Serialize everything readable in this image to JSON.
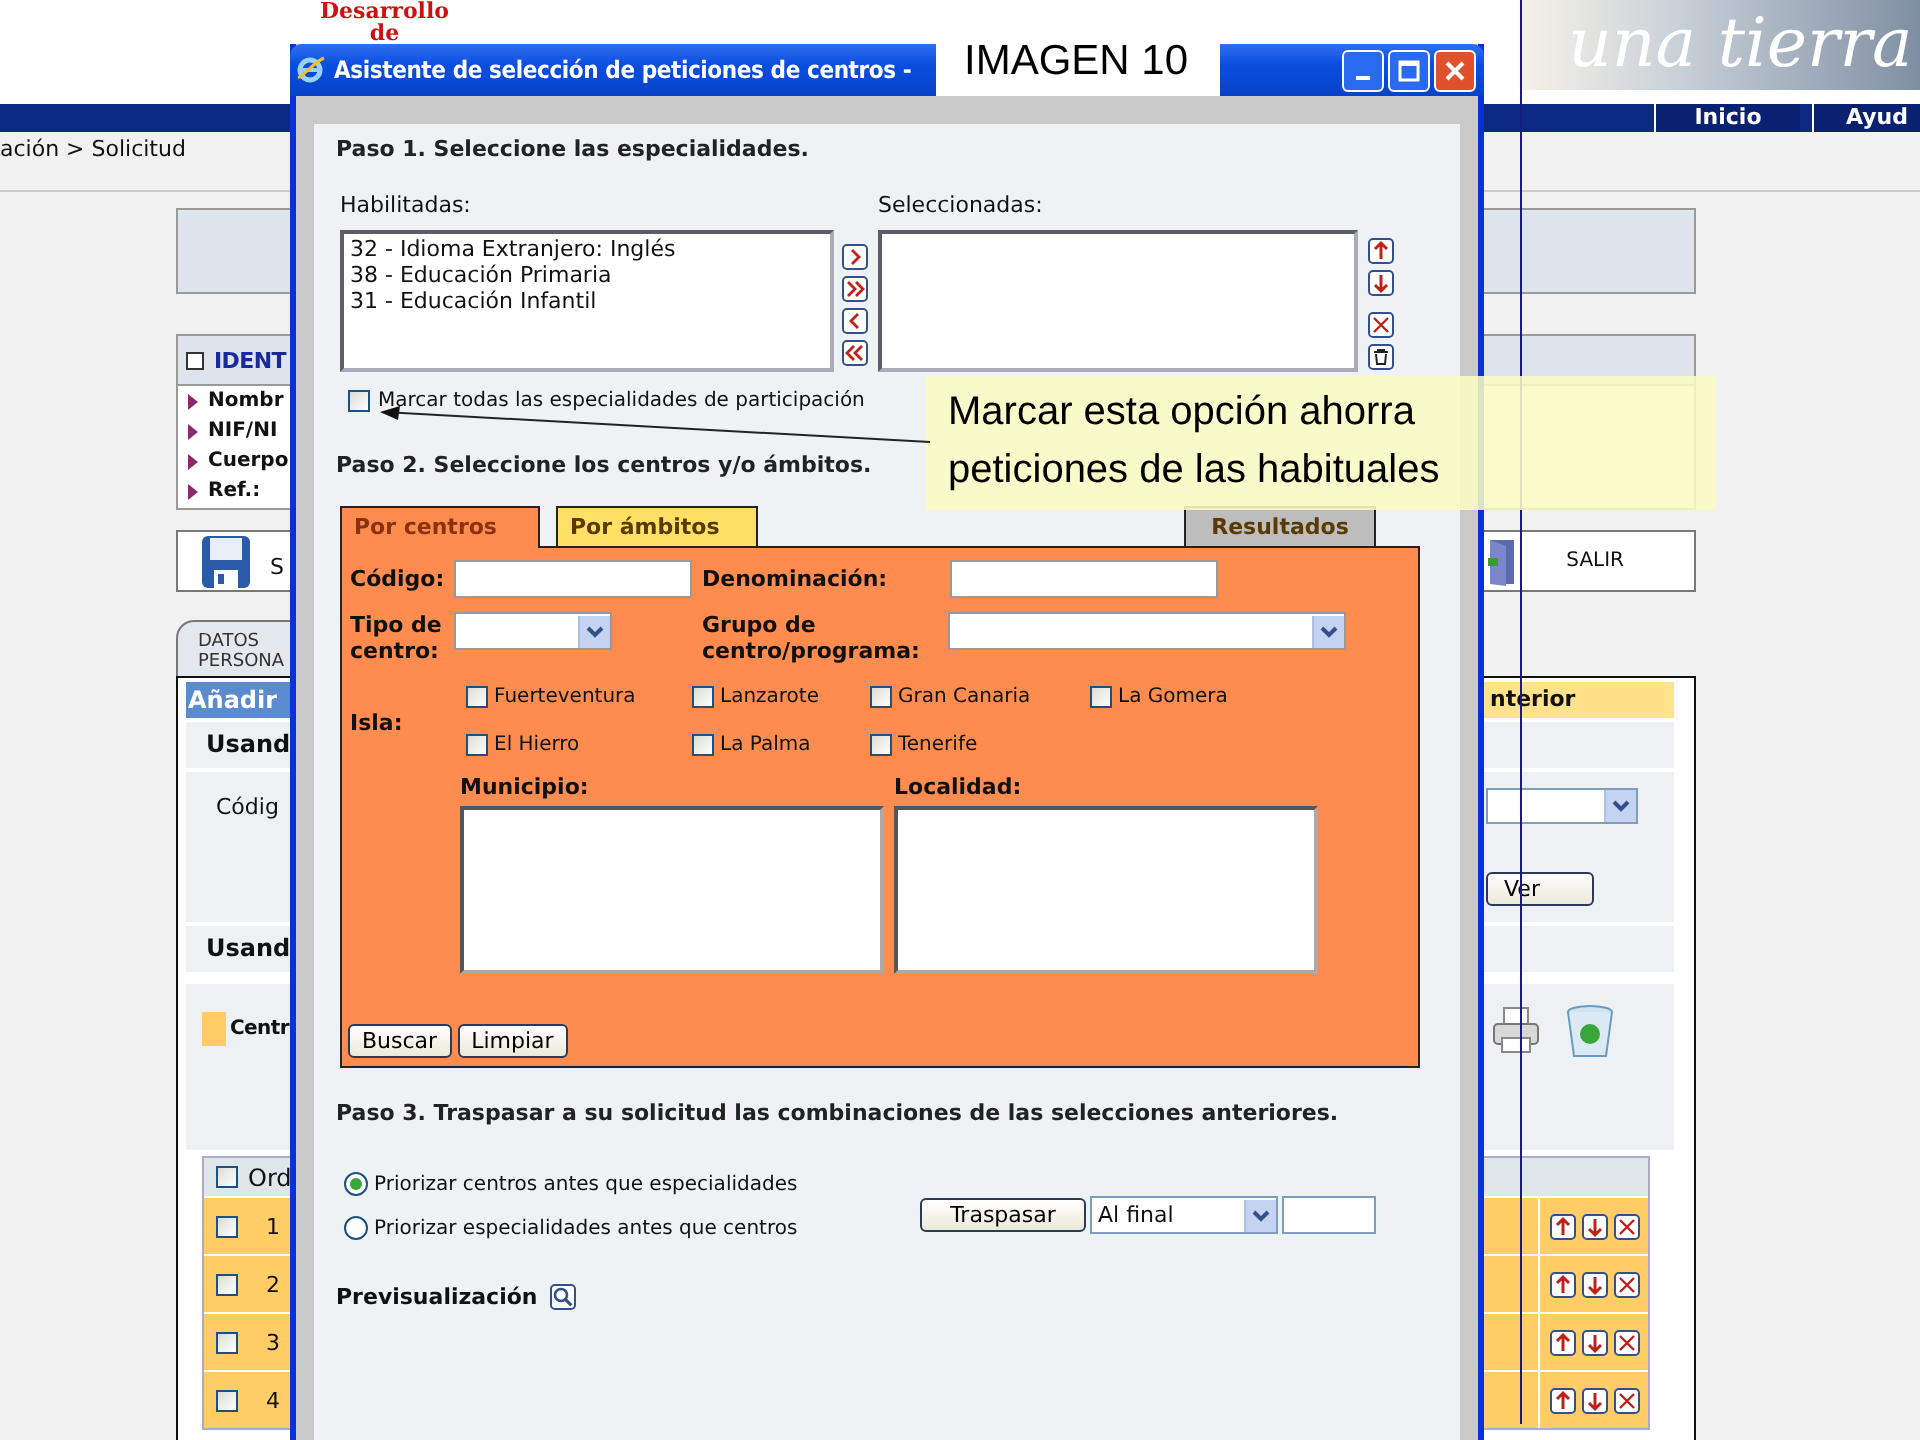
{
  "page": {
    "header": {
      "org_lines": [
        "Desarrollo",
        "de"
      ],
      "banner_text": "una tierra"
    },
    "nav": [
      {
        "label": "Inicio"
      },
      {
        "label": "Ayud"
      }
    ],
    "breadcrumb": "ación > Solicitud",
    "identification": {
      "title": "IDENT",
      "fields": [
        "Nombr",
        "NIF/NI",
        "Cuerpo",
        "Ref.:"
      ]
    },
    "toolbar": {
      "save_label": "S",
      "exit_label": "SALIR"
    },
    "tab": {
      "lines": [
        "DATOS",
        "PERSONA"
      ]
    },
    "section": {
      "title": "Añadir",
      "side_title": "nterior",
      "subheading_1": "Usand",
      "code_label": "Códig",
      "view_button": "Ver",
      "subheading_2": "Usand",
      "centers_label": "Centr"
    },
    "table": {
      "header": "Ord",
      "header_checked": false,
      "rows": [
        {
          "number": "1",
          "checked": false
        },
        {
          "number": "2",
          "checked": false
        },
        {
          "number": "3",
          "checked": false
        },
        {
          "number": "4",
          "checked": false
        }
      ]
    }
  },
  "dialog": {
    "title": "Asistente de selección de peticiones de centros -",
    "step1": {
      "heading": "Paso 1. Seleccione las especialidades.",
      "available_label": "Habilitadas:",
      "available": [
        "32 - Idioma Extranjero: Inglés",
        "38 - Educación Primaria",
        "31 - Educación Infantil"
      ],
      "selected_label": "Seleccionadas:",
      "select_all": {
        "label": "Marcar todas las especialidades de participación",
        "checked": false
      }
    },
    "step2": {
      "heading": "Paso 2. Seleccione los centros y/o ámbitos.",
      "tabs": [
        {
          "label": "Por centros",
          "selected": true,
          "color": "#ff8c4f"
        },
        {
          "label": "Por ámbitos",
          "selected": false,
          "color": "#ffe066"
        },
        {
          "label": "Resultados",
          "selected": false,
          "color": "#bdbdbd"
        }
      ],
      "code_label": "Código:",
      "name_label": "Denominación:",
      "type_label": "Tipo de centro:",
      "group_label": "Grupo de centro/programa:",
      "island_label": "Isla:",
      "islands": [
        {
          "label": "Fuerteventura",
          "checked": false
        },
        {
          "label": "Lanzarote",
          "checked": false
        },
        {
          "label": "Gran Canaria",
          "checked": false
        },
        {
          "label": "La Gomera",
          "checked": false
        },
        {
          "label": "El Hierro",
          "checked": false
        },
        {
          "label": "La Palma",
          "checked": false
        },
        {
          "label": "Tenerife",
          "checked": false
        }
      ],
      "municipality_label": "Municipio:",
      "locality_label": "Localidad:",
      "buttons": [
        "Buscar",
        "Limpiar"
      ]
    },
    "step3": {
      "heading": "Paso 3. Traspasar a su solicitud las combinaciones de las selecciones anteriores.",
      "priorities": [
        {
          "label": "Priorizar centros antes que especialidades",
          "selected": true
        },
        {
          "label": "Priorizar especialidades antes que centros",
          "selected": false
        }
      ],
      "transfer_button": "Traspasar",
      "position_value": "Al final"
    },
    "preview_label": "Previsualización"
  },
  "overlay_label": "IMAGEN 10",
  "callout": {
    "text": "Marcar esta opción ahorra peticiones de las habituales"
  }
}
